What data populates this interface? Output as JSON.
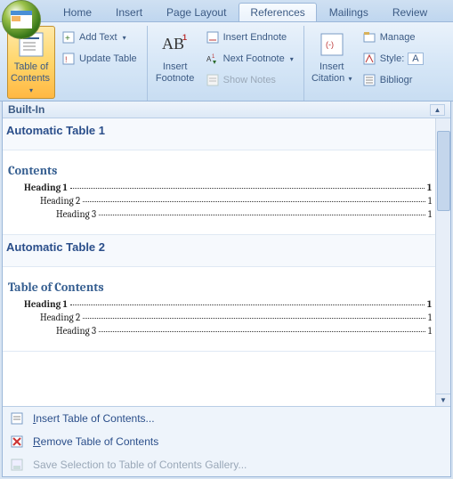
{
  "tabs": {
    "items": [
      "Home",
      "Insert",
      "Page Layout",
      "References",
      "Mailings",
      "Review"
    ],
    "activeIndex": 3
  },
  "ribbon": {
    "toc": {
      "bigLabel1": "Table of",
      "bigLabel2": "Contents",
      "addText": "Add Text",
      "updateTable": "Update Table"
    },
    "footnotes": {
      "bigLabel1": "Insert",
      "bigLabel2": "Footnote",
      "insertEndnote": "Insert Endnote",
      "nextFootnote": "Next Footnote",
      "showNotes": "Show Notes"
    },
    "citations": {
      "bigLabel1": "Insert",
      "bigLabel2": "Citation",
      "manage": "Manage",
      "style": "Style:",
      "styleValue": "A",
      "biblio": "Bibliogr"
    }
  },
  "dropdown": {
    "header": "Built-In",
    "previews": [
      {
        "title": "Automatic Table 1",
        "contentsHeading": "Contents",
        "rows": [
          {
            "label": "Heading 1",
            "page": "1",
            "indent": 1
          },
          {
            "label": "Heading 2",
            "page": "1",
            "indent": 2
          },
          {
            "label": "Heading 3",
            "page": "1",
            "indent": 3
          }
        ]
      },
      {
        "title": "Automatic Table 2",
        "contentsHeading": "Table of Contents",
        "rows": [
          {
            "label": "Heading 1",
            "page": "1",
            "indent": 1
          },
          {
            "label": "Heading 2",
            "page": "1",
            "indent": 2
          },
          {
            "label": "Heading 3",
            "page": "1",
            "indent": 3
          }
        ]
      }
    ],
    "menu": {
      "insert": "Insert Table of Contents...",
      "remove": "Remove Table of Contents",
      "save": "Save Selection to Table of Contents Gallery..."
    }
  }
}
